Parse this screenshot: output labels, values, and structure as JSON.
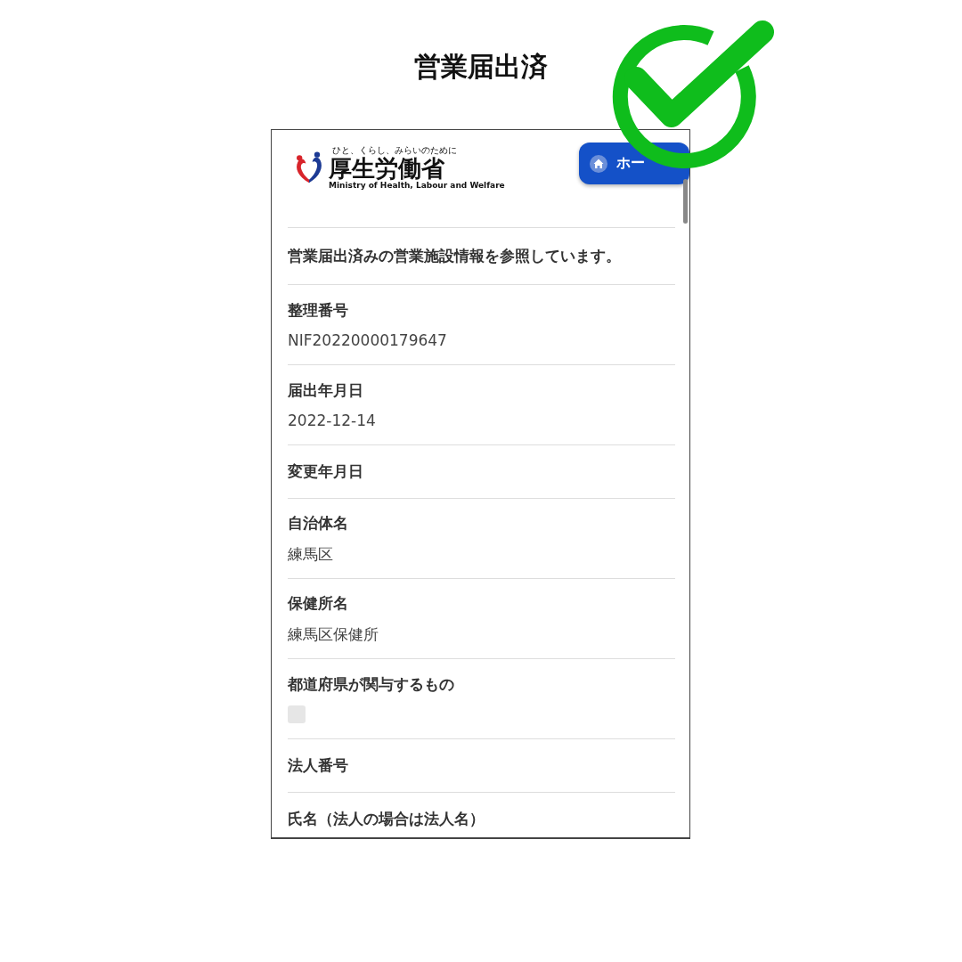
{
  "heading": "営業届出済",
  "header": {
    "logo_tagline": "ひと、くらし、みらいのために",
    "logo_name": "厚生労働省",
    "logo_english": "Ministry of Health, Labour and Welfare",
    "home_button": "ホー"
  },
  "intro": "営業届出済みの営業施設情報を参照しています。",
  "fields": [
    {
      "kind": "text",
      "label": "整理番号",
      "value": "NIF20220000179647"
    },
    {
      "kind": "text",
      "label": "届出年月日",
      "value": "2022-12-14"
    },
    {
      "kind": "text",
      "label": "変更年月日"
    },
    {
      "kind": "text",
      "label": "自治体名",
      "value": "練馬区"
    },
    {
      "kind": "text",
      "label": "保健所名",
      "value": "練馬区保健所"
    },
    {
      "kind": "checkbox",
      "label": "都道府県が関与するもの",
      "checked": false
    },
    {
      "kind": "text",
      "label": "法人番号"
    },
    {
      "kind": "text",
      "label": "氏名（法人の場合は法人名）"
    }
  ]
}
